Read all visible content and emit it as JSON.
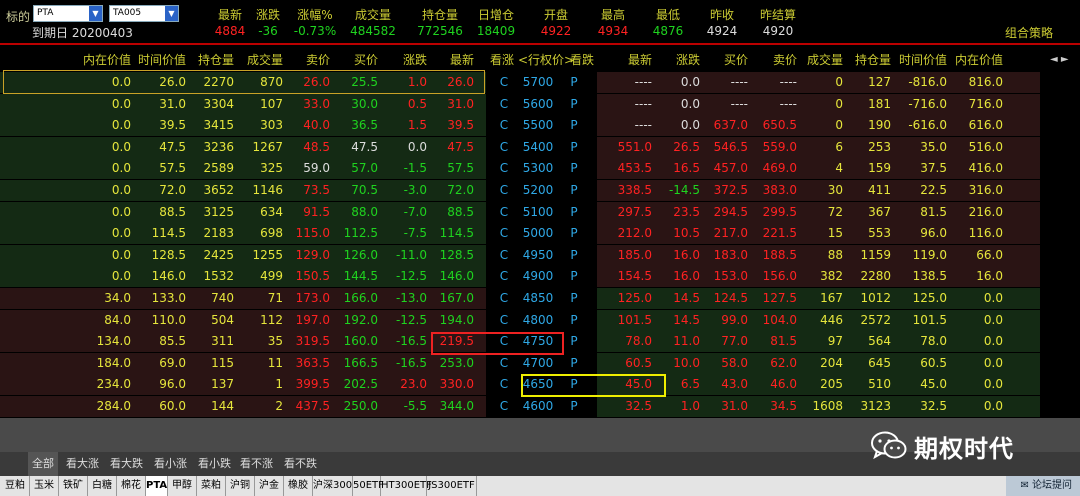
{
  "header": {
    "underlying_label": "标的",
    "underlying": "PTA",
    "contract": "TA005",
    "expiry_label": "到期日",
    "expiry": "20200403",
    "combo_label": "组合策略",
    "quote_headers": [
      "最新",
      "涨跌",
      "涨幅%",
      "成交量",
      "持仓量",
      "日增仓",
      "开盘",
      "最高",
      "最低",
      "昨收",
      "昨结算"
    ],
    "quote_values": [
      "4884",
      "-36",
      "-0.73%",
      "484582",
      "772546",
      "18409",
      "4922",
      "4934",
      "4876",
      "4924",
      "4920"
    ]
  },
  "table": {
    "call_headers": [
      "内在价值",
      "时间价值",
      "持仓量",
      "成交量",
      "卖价",
      "买价",
      "涨跌",
      "最新",
      "看涨"
    ],
    "mid_header": "<行权价>",
    "put_headers": [
      "看跌",
      "最新",
      "涨跌",
      "买价",
      "卖价",
      "成交量",
      "持仓量",
      "时间价值",
      "内在价值"
    ],
    "scroll_arrows": "◄ ►",
    "rows": [
      {
        "call": [
          "0.0",
          "26.0",
          "2270",
          "870",
          "26.0",
          "25.5",
          "1.0",
          "26.0"
        ],
        "cflag": "C",
        "strike": "5700",
        "pflag": "P",
        "put": [
          "----",
          "0.0",
          "----",
          "----",
          "0",
          "127",
          "-816.0",
          "816.0"
        ]
      },
      {
        "call": [
          "0.0",
          "31.0",
          "3304",
          "107",
          "33.0",
          "30.0",
          "0.5",
          "31.0"
        ],
        "cflag": "C",
        "strike": "5600",
        "pflag": "P",
        "put": [
          "----",
          "0.0",
          "----",
          "----",
          "0",
          "181",
          "-716.0",
          "716.0"
        ]
      },
      {
        "call": [
          "0.0",
          "39.5",
          "3415",
          "303",
          "40.0",
          "36.5",
          "1.5",
          "39.5"
        ],
        "cflag": "C",
        "strike": "5500",
        "pflag": "P",
        "put": [
          "----",
          "0.0",
          "637.0",
          "650.5",
          "0",
          "190",
          "-616.0",
          "616.0"
        ]
      },
      {
        "call": [
          "0.0",
          "47.5",
          "3236",
          "1267",
          "48.5",
          "47.5",
          "0.0",
          "47.5"
        ],
        "cflag": "C",
        "strike": "5400",
        "pflag": "P",
        "put": [
          "551.0",
          "26.5",
          "546.5",
          "559.0",
          "6",
          "253",
          "35.0",
          "516.0"
        ]
      },
      {
        "call": [
          "0.0",
          "57.5",
          "2589",
          "325",
          "59.0",
          "57.0",
          "-1.5",
          "57.5"
        ],
        "cflag": "C",
        "strike": "5300",
        "pflag": "P",
        "put": [
          "453.5",
          "16.5",
          "457.0",
          "469.0",
          "4",
          "159",
          "37.5",
          "416.0"
        ]
      },
      {
        "call": [
          "0.0",
          "72.0",
          "3652",
          "1146",
          "73.5",
          "70.5",
          "-3.0",
          "72.0"
        ],
        "cflag": "C",
        "strike": "5200",
        "pflag": "P",
        "put": [
          "338.5",
          "-14.5",
          "372.5",
          "383.0",
          "30",
          "411",
          "22.5",
          "316.0"
        ]
      },
      {
        "call": [
          "0.0",
          "88.5",
          "3125",
          "634",
          "91.5",
          "88.0",
          "-7.0",
          "88.5"
        ],
        "cflag": "C",
        "strike": "5100",
        "pflag": "P",
        "put": [
          "297.5",
          "23.5",
          "294.5",
          "299.5",
          "72",
          "367",
          "81.5",
          "216.0"
        ]
      },
      {
        "call": [
          "0.0",
          "114.5",
          "2183",
          "698",
          "115.0",
          "112.5",
          "-7.5",
          "114.5"
        ],
        "cflag": "C",
        "strike": "5000",
        "pflag": "P",
        "put": [
          "212.0",
          "10.5",
          "217.0",
          "221.5",
          "15",
          "553",
          "96.0",
          "116.0"
        ]
      },
      {
        "call": [
          "0.0",
          "128.5",
          "2425",
          "1255",
          "129.0",
          "126.0",
          "-11.0",
          "128.5"
        ],
        "cflag": "C",
        "strike": "4950",
        "pflag": "P",
        "put": [
          "185.0",
          "16.0",
          "183.0",
          "188.5",
          "88",
          "1159",
          "119.0",
          "66.0"
        ]
      },
      {
        "call": [
          "0.0",
          "146.0",
          "1532",
          "499",
          "150.5",
          "144.5",
          "-12.5",
          "146.0"
        ],
        "cflag": "C",
        "strike": "4900",
        "pflag": "P",
        "put": [
          "154.5",
          "16.0",
          "153.0",
          "156.0",
          "382",
          "2280",
          "138.5",
          "16.0"
        ]
      },
      {
        "call": [
          "34.0",
          "133.0",
          "740",
          "71",
          "173.0",
          "166.0",
          "-13.0",
          "167.0"
        ],
        "cflag": "C",
        "strike": "4850",
        "pflag": "P",
        "put": [
          "125.0",
          "14.5",
          "124.5",
          "127.5",
          "167",
          "1012",
          "125.0",
          "0.0"
        ]
      },
      {
        "call": [
          "84.0",
          "110.0",
          "504",
          "112",
          "197.0",
          "192.0",
          "-12.5",
          "194.0"
        ],
        "cflag": "C",
        "strike": "4800",
        "pflag": "P",
        "put": [
          "101.5",
          "14.5",
          "99.0",
          "104.0",
          "446",
          "2572",
          "101.5",
          "0.0"
        ]
      },
      {
        "call": [
          "134.0",
          "85.5",
          "311",
          "35",
          "319.5",
          "160.0",
          "-16.5",
          "219.5"
        ],
        "cflag": "C",
        "strike": "4750",
        "pflag": "P",
        "put": [
          "78.0",
          "11.0",
          "77.0",
          "81.5",
          "97",
          "564",
          "78.0",
          "0.0"
        ]
      },
      {
        "call": [
          "184.0",
          "69.0",
          "115",
          "11",
          "363.5",
          "166.5",
          "-16.5",
          "253.0"
        ],
        "cflag": "C",
        "strike": "4700",
        "pflag": "P",
        "put": [
          "60.5",
          "10.0",
          "58.0",
          "62.0",
          "204",
          "645",
          "60.5",
          "0.0"
        ]
      },
      {
        "call": [
          "234.0",
          "96.0",
          "137",
          "1",
          "399.5",
          "202.5",
          "23.0",
          "330.0"
        ],
        "cflag": "C",
        "strike": "4650",
        "pflag": "P",
        "put": [
          "45.0",
          "6.5",
          "43.0",
          "46.0",
          "205",
          "510",
          "45.0",
          "0.0"
        ]
      },
      {
        "call": [
          "284.0",
          "60.0",
          "144",
          "2",
          "437.5",
          "250.0",
          "-5.5",
          "344.0"
        ],
        "cflag": "C",
        "strike": "4600",
        "pflag": "P",
        "put": [
          "32.5",
          "1.0",
          "31.0",
          "34.5",
          "1608",
          "3123",
          "32.5",
          "0.0"
        ]
      }
    ]
  },
  "filters": [
    "全部",
    "看大涨",
    "看大跌",
    "看小涨",
    "看小跌",
    "看不涨",
    "看不跌"
  ],
  "bottom_tabs": [
    "豆粕",
    "玉米",
    "铁矿",
    "白糖",
    "棉花",
    "PTA",
    "甲醇",
    "菜粕",
    "沪铜",
    "沪金",
    "橡胶",
    "沪深300",
    "50ETF",
    "HT300ETF",
    "JS300ETF"
  ],
  "forum_label": "论坛提问",
  "watermark": "期权时代",
  "colors": {
    "up": "#ff2222",
    "down": "#1fd31f",
    "itm_call_bg": "#2a1414",
    "otm_call_bg": "#142a14",
    "accent": "#cccc33"
  }
}
